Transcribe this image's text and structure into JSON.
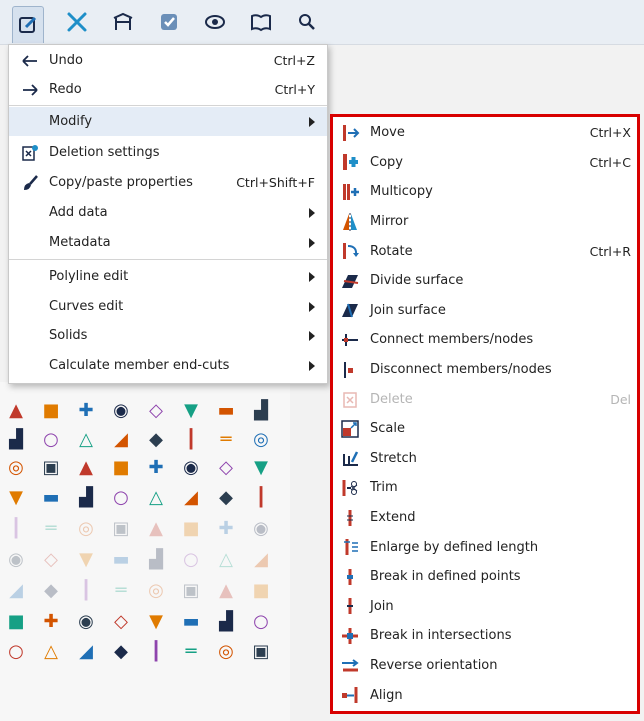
{
  "colors": {
    "accent": "#d80000",
    "icon_blue": "#1f6fb5",
    "icon_orange": "#e07b00",
    "icon_red": "#c0392b",
    "icon_dark": "#1b2a4a",
    "highlight": "#e4ecf6"
  },
  "toolbar": {
    "buttons": [
      {
        "icon": "edit-icon",
        "glyph": "✎"
      },
      {
        "icon": "tools-icon",
        "glyph": "✂"
      },
      {
        "icon": "structure-icon",
        "glyph": "⛩"
      },
      {
        "icon": "check-icon",
        "glyph": "✔"
      },
      {
        "icon": "view-icon",
        "glyph": "◉"
      },
      {
        "icon": "book-icon",
        "glyph": "✉"
      },
      {
        "icon": "search-icon",
        "glyph": "🔍"
      }
    ]
  },
  "main_menu": {
    "items": [
      {
        "label": "Undo",
        "shortcut": "Ctrl+Z",
        "icon": "undo-icon",
        "submenu": false
      },
      {
        "label": "Redo",
        "shortcut": "Ctrl+Y",
        "icon": "redo-icon",
        "submenu": false
      },
      {
        "label": "Modify",
        "shortcut": "",
        "icon": "",
        "submenu": true,
        "highlighted": true
      },
      {
        "label": "Deletion settings",
        "shortcut": "",
        "icon": "deletion-settings-icon",
        "submenu": false
      },
      {
        "label": "Copy/paste properties",
        "shortcut": "Ctrl+Shift+F",
        "icon": "brush-icon",
        "submenu": false
      },
      {
        "label": "Add data",
        "shortcut": "",
        "icon": "",
        "submenu": true
      },
      {
        "label": "Metadata",
        "shortcut": "",
        "icon": "",
        "submenu": true
      },
      {
        "label": "Polyline edit",
        "shortcut": "",
        "icon": "",
        "submenu": true
      },
      {
        "label": "Curves edit",
        "shortcut": "",
        "icon": "",
        "submenu": true
      },
      {
        "label": "Solids",
        "shortcut": "",
        "icon": "",
        "submenu": true
      },
      {
        "label": "Calculate member end-cuts",
        "shortcut": "",
        "icon": "",
        "submenu": true
      }
    ]
  },
  "modify_menu": {
    "items": [
      {
        "label": "Move",
        "shortcut": "Ctrl+X",
        "icon": "move-icon",
        "disabled": false
      },
      {
        "label": "Copy",
        "shortcut": "Ctrl+C",
        "icon": "copy-icon",
        "disabled": false
      },
      {
        "label": "Multicopy",
        "shortcut": "",
        "icon": "multicopy-icon",
        "disabled": false
      },
      {
        "label": "Mirror",
        "shortcut": "",
        "icon": "mirror-icon",
        "disabled": false
      },
      {
        "label": "Rotate",
        "shortcut": "Ctrl+R",
        "icon": "rotate-icon",
        "disabled": false
      },
      {
        "label": "Divide surface",
        "shortcut": "",
        "icon": "divide-surface-icon",
        "disabled": false
      },
      {
        "label": "Join surface",
        "shortcut": "",
        "icon": "join-surface-icon",
        "disabled": false
      },
      {
        "label": "Connect members/nodes",
        "shortcut": "",
        "icon": "connect-icon",
        "disabled": false
      },
      {
        "label": "Disconnect members/nodes",
        "shortcut": "",
        "icon": "disconnect-icon",
        "disabled": false
      },
      {
        "label": "Delete",
        "shortcut": "Del",
        "icon": "delete-icon",
        "disabled": true
      },
      {
        "label": "Scale",
        "shortcut": "",
        "icon": "scale-icon",
        "disabled": false
      },
      {
        "label": "Stretch",
        "shortcut": "",
        "icon": "stretch-icon",
        "disabled": false
      },
      {
        "label": "Trim",
        "shortcut": "",
        "icon": "trim-icon",
        "disabled": false
      },
      {
        "label": "Extend",
        "shortcut": "",
        "icon": "extend-icon",
        "disabled": false
      },
      {
        "label": "Enlarge by defined length",
        "shortcut": "",
        "icon": "enlarge-icon",
        "disabled": false
      },
      {
        "label": "Break in defined points",
        "shortcut": "",
        "icon": "break-points-icon",
        "disabled": false
      },
      {
        "label": "Join",
        "shortcut": "",
        "icon": "join-icon",
        "disabled": false
      },
      {
        "label": "Break in intersections",
        "shortcut": "",
        "icon": "break-intersections-icon",
        "disabled": false
      },
      {
        "label": "Reverse orientation",
        "shortcut": "",
        "icon": "reverse-icon",
        "disabled": false
      },
      {
        "label": "Align",
        "shortcut": "",
        "icon": "align-icon",
        "disabled": false
      }
    ]
  },
  "tool_grid": {
    "rows": [
      [
        "cone-icon",
        "dish-icon",
        "beam-end-icon",
        "frame-icon",
        "columns-icon",
        "structure-icon",
        "cross-icon",
        "member-icon"
      ],
      [
        "pipe-icon",
        "dash-member-icon",
        "double-o-icon",
        "curve-icon",
        "a-frame-icon",
        "span-x-icon",
        "span-y-icon",
        "span-z-icon"
      ],
      [
        "tx-icon",
        "ty-icon",
        "tz-icon",
        "diag-icon",
        "grid-x-icon",
        "grid-y-icon",
        "grid-z-icon",
        "arrow-icon"
      ],
      [
        "circle-icon",
        "ring-icon",
        "ring-bold-icon",
        "angle-icon",
        "target-icon",
        "pentagon-icon",
        "frame-round-icon",
        "shell-icon"
      ],
      [
        "cylinder-icon",
        "surface-icon",
        "beam-icon",
        "plate-icon",
        "slab-icon",
        "rod-icon",
        "bar-icon",
        "tube-icon"
      ],
      [
        "load-icon",
        "load2-icon",
        "load3-icon",
        "load4-icon",
        "load5-icon",
        "load6-icon",
        "load7-icon",
        "load8-icon"
      ],
      [
        "panel-icon",
        "panel2-icon",
        "panel3-icon",
        "panel4-icon",
        "panel5-icon",
        "panel6-icon",
        "panel7-icon",
        "panel8-icon"
      ],
      [
        "support-icon",
        "support2-icon",
        "support3-icon",
        "support4-icon",
        "curved-beam-icon",
        "arch-icon",
        "arch-bold-icon",
        "metal-icon"
      ],
      [
        "diagonal-icon",
        "mesh-icon",
        "node-icon",
        "prism-icon",
        "box-icon",
        "gradient-icon",
        "roof-icon",
        "pipe-red-icon"
      ]
    ]
  }
}
